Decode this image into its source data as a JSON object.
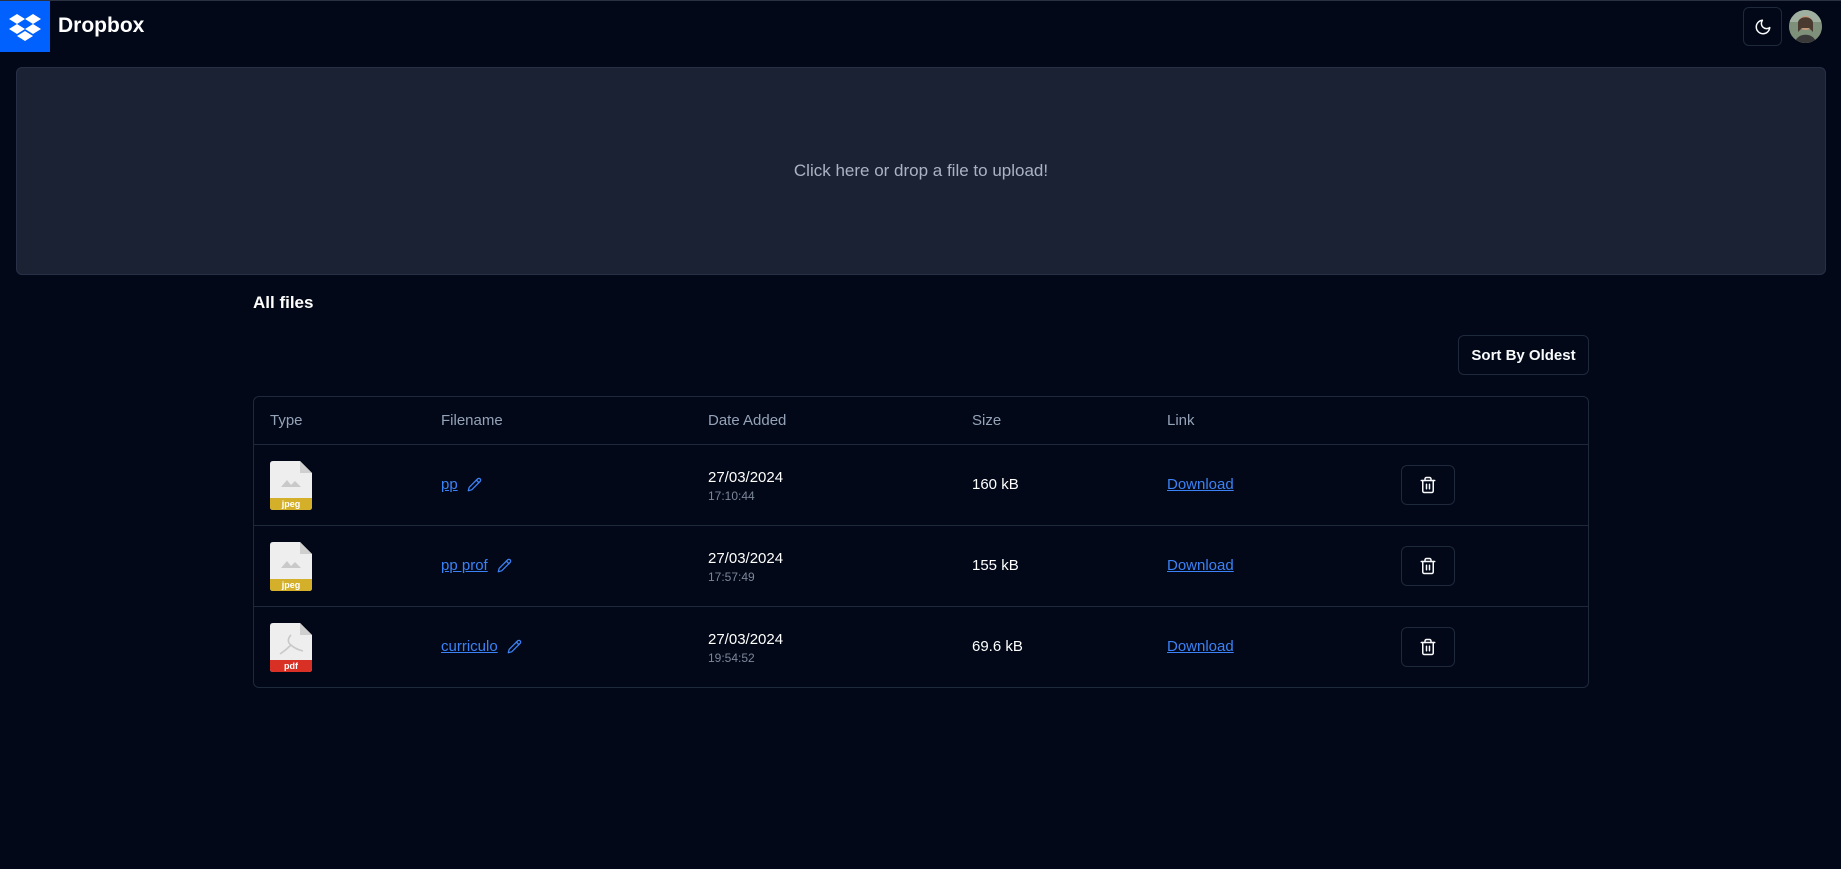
{
  "header": {
    "brand": "Dropbox",
    "logo_icon": "dropbox-logo-icon",
    "theme_toggle_icon": "moon-icon",
    "avatar_icon": "user-avatar"
  },
  "upload": {
    "prompt": "Click here or drop a file to upload!"
  },
  "files_section": {
    "title": "All files",
    "sort_button": "Sort By Oldest"
  },
  "table": {
    "headers": [
      "Type",
      "Filename",
      "Date Added",
      "Size",
      "Link"
    ],
    "rows": [
      {
        "type": "jpeg",
        "filename": "pp",
        "date": "27/03/2024",
        "time": "17:10:44",
        "size": "160 kB",
        "link": "Download"
      },
      {
        "type": "jpeg",
        "filename": "pp prof",
        "date": "27/03/2024",
        "time": "17:57:49",
        "size": "155 kB",
        "link": "Download"
      },
      {
        "type": "pdf",
        "filename": "curriculo",
        "date": "27/03/2024",
        "time": "19:54:52",
        "size": "69.6 kB",
        "link": "Download"
      }
    ]
  },
  "colors": {
    "background": "#020817",
    "brand_blue": "#0061fe",
    "link_blue": "#3b82f6",
    "jpeg_badge": "#d4b02a",
    "pdf_badge": "#d93025"
  }
}
